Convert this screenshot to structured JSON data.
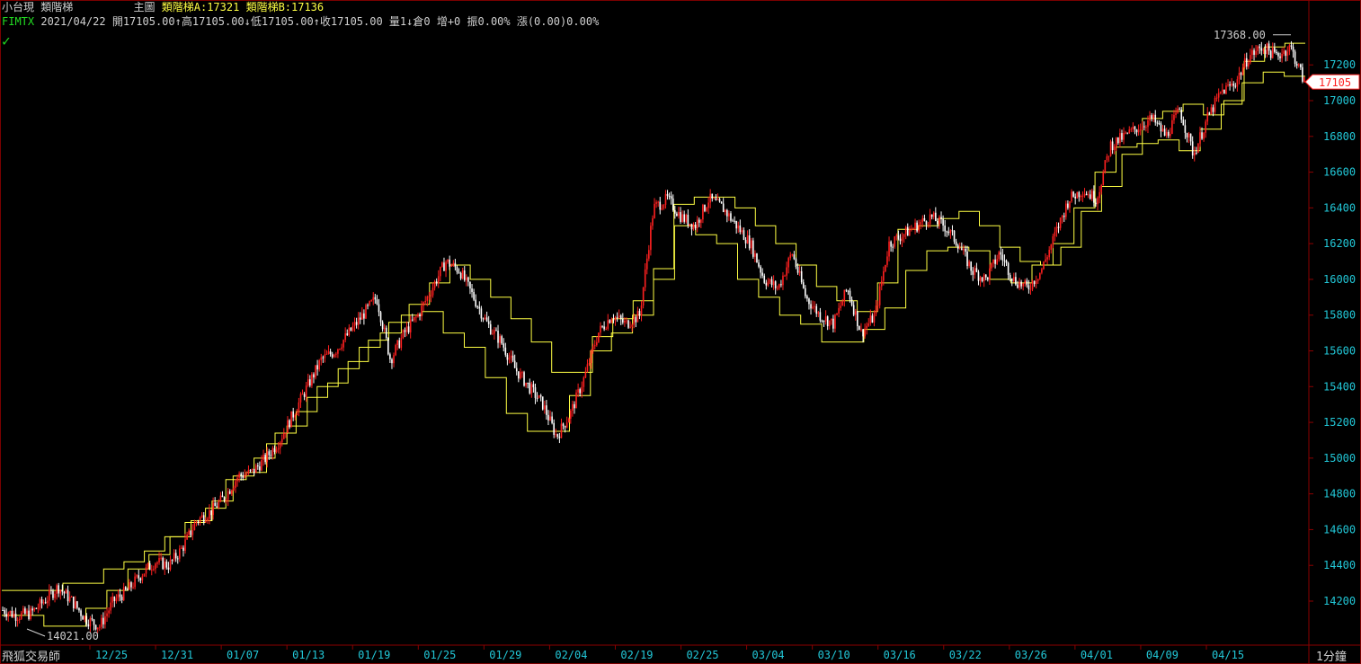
{
  "header": {
    "symbol": "小台現",
    "indicator": "類階梯",
    "main_label": "主圖",
    "ladder_a": "類階梯A:17321",
    "ladder_b": "類階梯B:17136",
    "code": "FIMTX",
    "quote": "2021/04/22 開17105.00↑高17105.00↓低17105.00↑收17105.00 量1↓倉0 增+0 振0.00% 漲(0.00)0.00%"
  },
  "footer": {
    "brand": "飛狐交易師",
    "interval": "1分鐘"
  },
  "colors": {
    "background": "#000000",
    "axis": "#8b0000",
    "tick_text": "#22c8d8",
    "ladder": "#ffff44",
    "candle_up": "#ff2020",
    "candle_down": "#ffffff",
    "last_price": "#ff2020"
  },
  "chart_data": {
    "type": "candlestick",
    "ylim": [
      14021,
      17368
    ],
    "yticks": [
      14200,
      14400,
      14600,
      14800,
      15000,
      15200,
      15400,
      15600,
      15800,
      16000,
      16200,
      16400,
      16600,
      16800,
      17000,
      17200
    ],
    "xticks": [
      "12/25",
      "12/31",
      "01/07",
      "01/13",
      "01/19",
      "01/25",
      "01/29",
      "02/04",
      "02/19",
      "02/25",
      "03/04",
      "03/10",
      "03/16",
      "03/22",
      "03/26",
      "04/01",
      "04/09",
      "04/15"
    ],
    "high_label": "17368.00",
    "low_label": "14021.00",
    "last_price": "17105",
    "close_path": [
      14150,
      14120,
      14130,
      14200,
      14280,
      14200,
      14100,
      14060,
      14200,
      14260,
      14350,
      14420,
      14400,
      14500,
      14650,
      14700,
      14780,
      14900,
      14920,
      15000,
      15100,
      15250,
      15400,
      15550,
      15600,
      15700,
      15800,
      15900,
      15550,
      15700,
      15800,
      15950,
      16100,
      16050,
      15900,
      15750,
      15650,
      15500,
      15400,
      15300,
      15120,
      15250,
      15450,
      15700,
      15800,
      15750,
      15800,
      16400,
      16450,
      16350,
      16300,
      16450,
      16400,
      16300,
      16200,
      16000,
      15950,
      16150,
      15900,
      15800,
      15750,
      15950,
      15700,
      15800,
      16200,
      16250,
      16300,
      16350,
      16300,
      16200,
      16050,
      16000,
      16150,
      16000,
      15950,
      16050,
      16250,
      16450,
      16500,
      16450,
      16750,
      16800,
      16850,
      16900,
      16800,
      16950,
      16700,
      16900,
      17050,
      17100,
      17250,
      17300,
      17250,
      17300,
      17105
    ],
    "ladder_a": [
      14260,
      14260,
      14260,
      14300,
      14300,
      14380,
      14420,
      14480,
      14560,
      14640,
      14720,
      14880,
      14920,
      15080,
      15180,
      15340,
      15420,
      15540,
      15660,
      15760,
      15860,
      15980,
      16080,
      16000,
      15900,
      15780,
      15650,
      15480,
      15480,
      15680,
      15780,
      15880,
      16060,
      16420,
      16460,
      16460,
      16400,
      16300,
      16200,
      16080,
      15960,
      15880,
      15820,
      15980,
      16280,
      16300,
      16340,
      16380,
      16300,
      16180,
      16100,
      16080,
      16180,
      16380,
      16520,
      16700,
      16900,
      16940,
      16980,
      16920,
      17000,
      17220,
      17300,
      17321
    ],
    "ladder_b": [
      14120,
      14120,
      14060,
      14060,
      14160,
      14260,
      14380,
      14460,
      14560,
      14650,
      14760,
      14900,
      15000,
      15140,
      15260,
      15400,
      15500,
      15620,
      15700,
      15800,
      15820,
      15700,
      15620,
      15450,
      15250,
      15150,
      15150,
      15350,
      15600,
      15700,
      15800,
      16000,
      16300,
      16250,
      16200,
      16000,
      15900,
      15800,
      15750,
      15650,
      15650,
      15720,
      15840,
      16050,
      16160,
      16180,
      16160,
      16000,
      15980,
      16080,
      16200,
      16400,
      16600,
      16740,
      16760,
      16780,
      16720,
      16840,
      16980,
      17100,
      17160,
      17136
    ]
  }
}
